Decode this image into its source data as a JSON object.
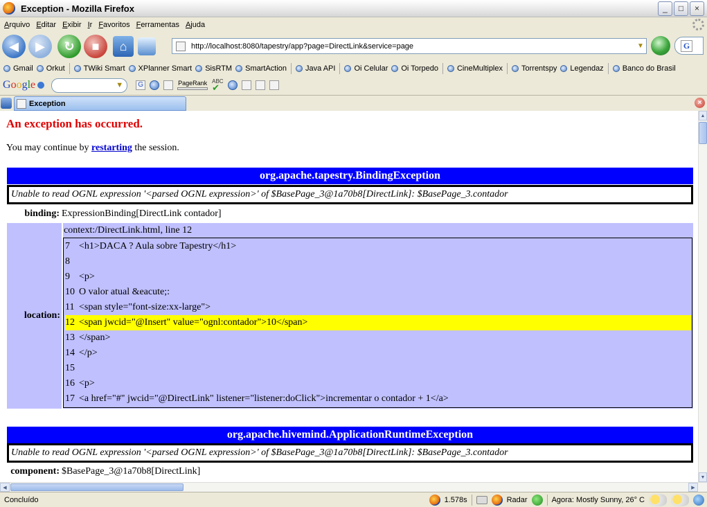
{
  "window": {
    "title": "Exception - Mozilla Firefox"
  },
  "menu": [
    "Arquivo",
    "Editar",
    "Exibir",
    "Ir",
    "Favoritos",
    "Ferramentas",
    "Ajuda"
  ],
  "nav": {
    "url": "http://localhost:8080/tapestry/app?page=DirectLink&service=page",
    "search_engine_icon": "G"
  },
  "bookmarks": [
    "Gmail",
    "Orkut",
    "TWiki Smart",
    "XPlanner Smart",
    "SisRTM",
    "SmartAction",
    "Java API",
    "Oi Celular",
    "Oi Torpedo",
    "CineMultiplex",
    "Torrentspy",
    "Legendaz",
    "Banco do Brasil"
  ],
  "google_toolbar": {
    "logo": "Google",
    "pagerank_label": "PageRank",
    "abc_label": "ABC"
  },
  "tab": {
    "label": "Exception"
  },
  "page": {
    "heading": "An exception has occurred.",
    "continue_pre": "You may continue by ",
    "continue_link": "restarting",
    "continue_post": " the session.",
    "exception1": {
      "name": "org.apache.tapestry.BindingException",
      "message": "Unable to read OGNL expression '<parsed OGNL expression>' of $BasePage_3@1a70b8[DirectLink]: $BasePage_3.contador",
      "binding_label": "binding:",
      "binding_value": "ExpressionBinding[DirectLink contador]",
      "location_label": "location:",
      "location_context": "context:/DirectLink.html, line 12",
      "code": [
        {
          "n": "7",
          "t": "<h1>DACA ? Aula sobre Tapestry</h1>"
        },
        {
          "n": "8",
          "t": ""
        },
        {
          "n": "9",
          "t": "<p>"
        },
        {
          "n": "10",
          "t": "O valor atual &eacute;:"
        },
        {
          "n": "11",
          "t": "<span style=\"font-size:xx-large\">"
        },
        {
          "n": "12",
          "t": "<span jwcid=\"@Insert\" value=\"ognl:contador\">10</span>"
        },
        {
          "n": "13",
          "t": "</span>"
        },
        {
          "n": "14",
          "t": "</p>"
        },
        {
          "n": "15",
          "t": ""
        },
        {
          "n": "16",
          "t": "<p>"
        },
        {
          "n": "17",
          "t": "<a href=\"#\" jwcid=\"@DirectLink\" listener=\"listener:doClick\">incrementar o contador + 1</a>"
        }
      ],
      "highlight_line": "12"
    },
    "exception2": {
      "name": "org.apache.hivemind.ApplicationRuntimeException",
      "message": "Unable to read OGNL expression '<parsed OGNL expression>' of $BasePage_3@1a70b8[DirectLink]: $BasePage_3.contador",
      "component_label": "component:",
      "component_value": "$BasePage_3@1a70b8[DirectLink]"
    }
  },
  "status": {
    "text": "Concluído",
    "timing": "1.578s",
    "radar": "Radar",
    "weather": "Agora: Mostly Sunny, 26° C"
  },
  "colors": {
    "exception_bar": "#0000ff",
    "location_bg": "#c0c0ff",
    "highlight": "#ffff00",
    "heading": "#e10000"
  }
}
